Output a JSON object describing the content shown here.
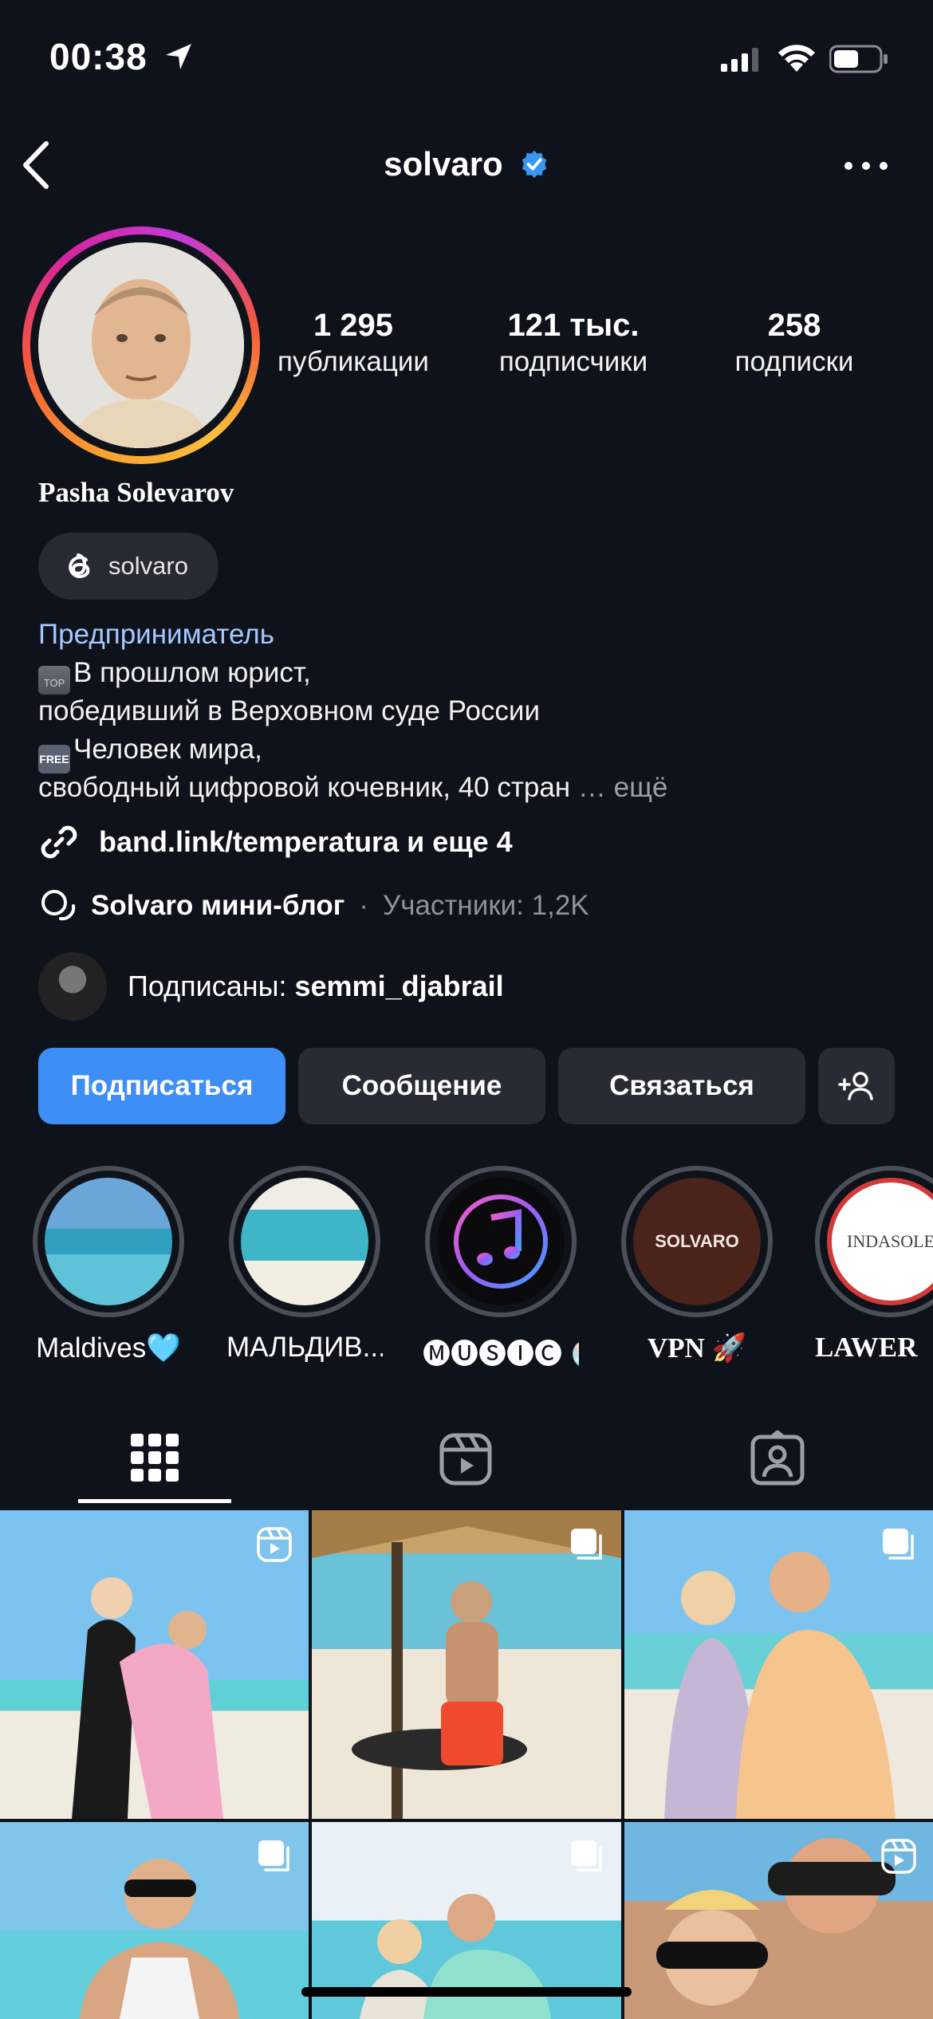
{
  "status_bar": {
    "time": "00:38"
  },
  "header": {
    "username": "solvaro"
  },
  "profile": {
    "stats": [
      {
        "value": "1 295",
        "label": "публикации"
      },
      {
        "value": "121 тыс.",
        "label": "подписчики"
      },
      {
        "value": "258",
        "label": "подписки"
      }
    ],
    "full_name": "Pasha Solevarov",
    "threads_handle": "solvaro",
    "category": "Предприниматель",
    "bio": [
      "В прошлом юрист,",
      "победивший в Верховном суде России",
      "Человек мира,",
      "свободный цифровой кочевник, 40 стран"
    ],
    "bio_more": "… ещё",
    "link": "band.link/temperatura и еще 4",
    "channel": {
      "name": "Solvaro мини-блог",
      "separator": "·",
      "members": "Участники: 1,2K"
    },
    "followed_by": {
      "prefix": "Подписаны: ",
      "user": "semmi_djabrail"
    }
  },
  "buttons": {
    "follow": "Подписаться",
    "message": "Сообщение",
    "contact": "Связаться"
  },
  "highlights": [
    {
      "label": "Maldives🩵"
    },
    {
      "label": "МАЛЬДИВ..."
    },
    {
      "label": "🅜🅤🅢🅘🅒 💿"
    },
    {
      "label": "VPN 🚀"
    },
    {
      "label": "LAWER"
    }
  ],
  "highlight_texts": {
    "solvaro_logo": "SOLVARO",
    "indasole_logo": "INDASOLE"
  },
  "tabs": [
    "grid-tab",
    "reels-tab",
    "tagged-tab"
  ],
  "colors": {
    "background": "#0e121b",
    "accent": "#3e8ef7",
    "verified": "#3897f0"
  }
}
